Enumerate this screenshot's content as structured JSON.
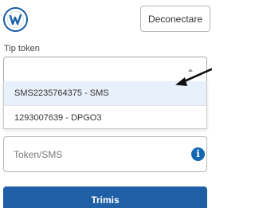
{
  "header": {
    "logo_icon": "brand-logo-icon",
    "logout_label": "Deconectare"
  },
  "token_type": {
    "label": "Tip token",
    "selected_value": "",
    "options": [
      {
        "label": "SMS2235764375 - SMS",
        "highlighted": true
      },
      {
        "label": "1293007639 - DPGO3",
        "highlighted": false
      }
    ]
  },
  "token_input": {
    "placeholder": "Token/SMS",
    "value": "",
    "info_icon": "info-icon",
    "info_glyph": "i"
  },
  "submit": {
    "label": "Trimis"
  },
  "colors": {
    "brand": "#1a5fa8",
    "primary_button": "#1f5fa6",
    "info_icon": "#1266b3",
    "highlight": "#e8f0fb"
  }
}
